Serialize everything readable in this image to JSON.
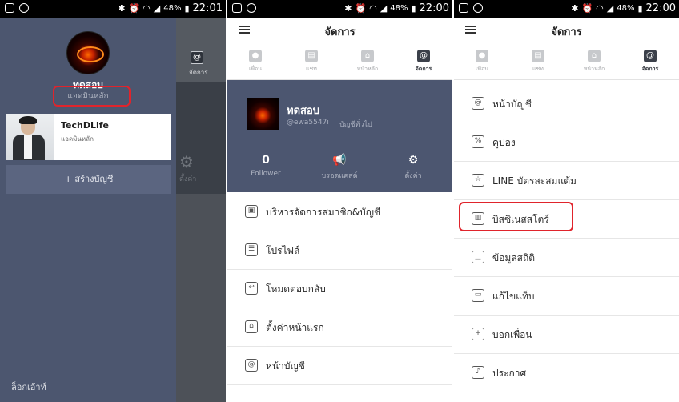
{
  "status": {
    "screen1": {
      "battery": "48%",
      "time": "22:01"
    },
    "screen2": {
      "battery": "48%",
      "time": "22:00"
    },
    "screen3": {
      "battery": "48%",
      "time": "22:00"
    }
  },
  "drawer": {
    "name": "ทดสอบ",
    "role": "แอดมินหลัก",
    "account": {
      "name": "TechDLife",
      "role": "แอดมินหลัก"
    },
    "create_account": "+ สร้างบัญชี",
    "logout": "ล็อกเอ้าท์",
    "dimmed_tab": "จัดการ",
    "dimmed_settings": "ตั้งค่า"
  },
  "appbar": {
    "title": "จัดการ"
  },
  "tabs": [
    {
      "label": "เพื่อน",
      "icon": "person-icon",
      "active": false
    },
    {
      "label": "แชท",
      "icon": "chat-icon",
      "active": false
    },
    {
      "label": "หน้าหลัก",
      "icon": "home-icon",
      "active": false
    },
    {
      "label": "จัดการ",
      "icon": "manage-icon",
      "active": true
    }
  ],
  "profile": {
    "name": "ทดสอบ",
    "id": "@ewa5547i",
    "kind": "บัญชีทั่วไป",
    "followers_count": "0",
    "followers_label": "Follower",
    "broadcast_label": "บรอดแคสต์",
    "settings_label": "ตั้งค่า"
  },
  "menu2": [
    {
      "label": "บริหารจัดการสมาชิก&บัญชี",
      "icon": "members-icon"
    },
    {
      "label": "โปรไฟล์",
      "icon": "profile-icon"
    },
    {
      "label": "โหมดตอบกลับ",
      "icon": "reply-icon"
    },
    {
      "label": "ตั้งค่าหน้าแรก",
      "icon": "home-icon"
    },
    {
      "label": "หน้าบัญชี",
      "icon": "at-icon"
    }
  ],
  "menu3": [
    {
      "label": "หน้าบัญชี",
      "icon": "at-icon"
    },
    {
      "label": "คูปอง",
      "icon": "coupon-icon"
    },
    {
      "label": "LINE บัตรสะสมแต้ม",
      "icon": "star-icon"
    },
    {
      "label": "บิสซิเนสสโตร์",
      "icon": "store-icon"
    },
    {
      "label": "ข้อมูลสถิติ",
      "icon": "stats-icon"
    },
    {
      "label": "แก้ไขแท็บ",
      "icon": "tab-edit-icon"
    },
    {
      "label": "บอกเพื่อน",
      "icon": "add-friend-icon"
    },
    {
      "label": "ประกาศ",
      "icon": "bell-icon"
    }
  ],
  "colors": {
    "navy": "#4c5670",
    "highlight": "#e0242c"
  }
}
